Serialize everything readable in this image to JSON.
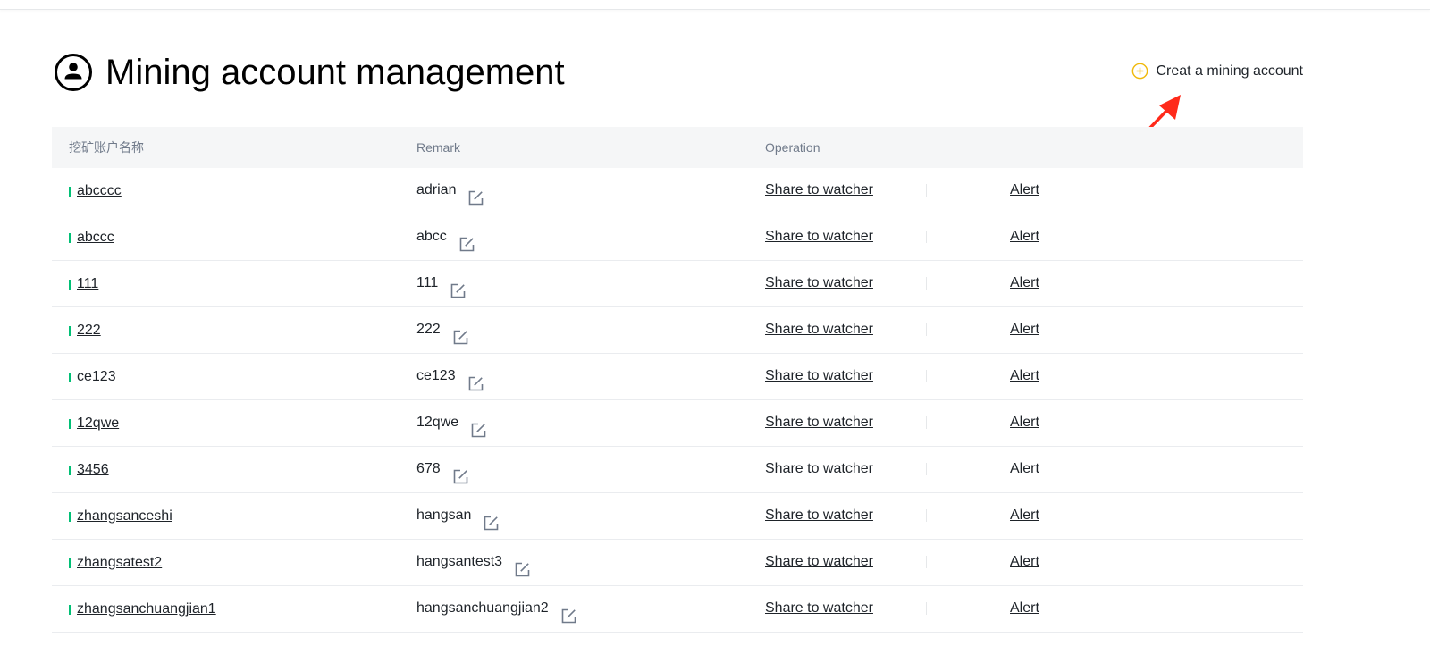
{
  "header": {
    "title": "Mining account management",
    "create_label": "Creat a mining account"
  },
  "table": {
    "columns": [
      "挖矿账户名称",
      "Remark",
      "Operation"
    ],
    "share_label": "Share to watcher",
    "alert_label": "Alert",
    "rows": [
      {
        "name": "abcccc",
        "remark": "adrian"
      },
      {
        "name": "abccc",
        "remark": "abcc"
      },
      {
        "name": "111",
        "remark": "111"
      },
      {
        "name": "222",
        "remark": "222"
      },
      {
        "name": "ce123",
        "remark": "ce123"
      },
      {
        "name": "12qwe",
        "remark": "12qwe"
      },
      {
        "name": "3456",
        "remark": "678"
      },
      {
        "name": "zhangsanceshi",
        "remark": "hangsan"
      },
      {
        "name": "zhangsatest2",
        "remark": "hangsantest3"
      },
      {
        "name": "zhangsanchuangjian1",
        "remark": "hangsanchuangjian2"
      }
    ]
  },
  "icons": {
    "title": "user-circle-icon",
    "create": "plus-circle-icon",
    "edit": "edit-icon",
    "annotation": "red-arrow"
  },
  "colors": {
    "accent": "#f0b90b",
    "row_marker": "#02c076",
    "annotation_arrow": "#ff2a1a"
  }
}
